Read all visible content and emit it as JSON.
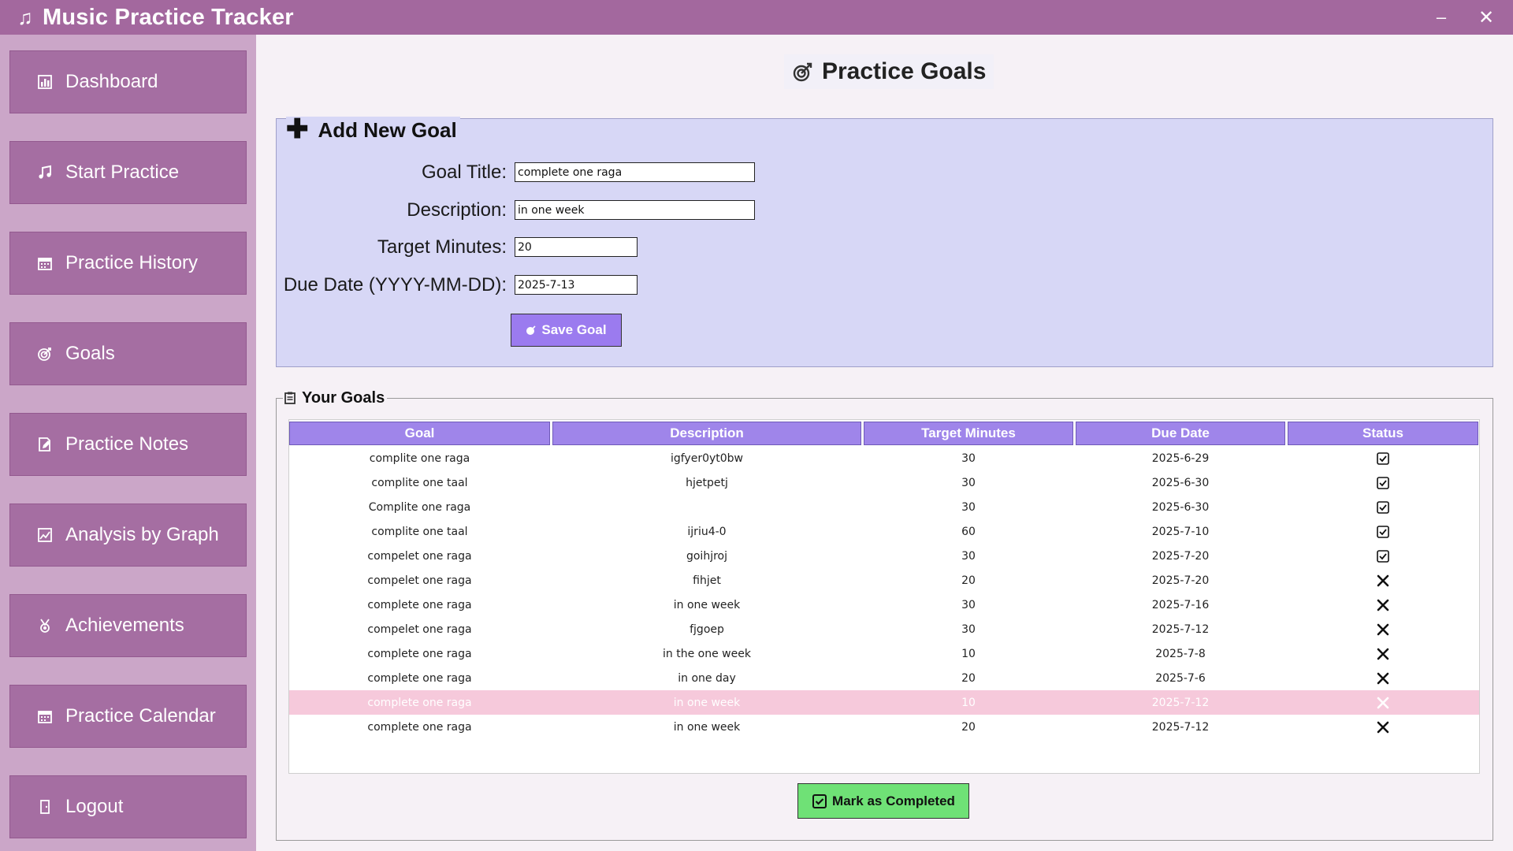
{
  "app": {
    "title": "Music Practice Tracker"
  },
  "window": {
    "minimize": "–",
    "close": "✕"
  },
  "sidebar": {
    "items": [
      {
        "label": "Dashboard",
        "icon": "bar-chart-icon"
      },
      {
        "label": "Start Practice",
        "icon": "music-note-icon"
      },
      {
        "label": "Practice History",
        "icon": "calendar-icon"
      },
      {
        "label": "Goals",
        "icon": "target-icon"
      },
      {
        "label": "Practice Notes",
        "icon": "note-edit-icon"
      },
      {
        "label": "Analysis by Graph",
        "icon": "line-chart-icon"
      },
      {
        "label": "Achievements",
        "icon": "medal-icon"
      },
      {
        "label": "Practice Calendar",
        "icon": "calendar-icon"
      },
      {
        "label": "Logout",
        "icon": "door-icon"
      }
    ]
  },
  "page": {
    "title": "Practice Goals"
  },
  "add_goal": {
    "legend": "Add New Goal",
    "fields": {
      "title": {
        "label": "Goal Title:",
        "value": "complete one raga"
      },
      "description": {
        "label": "Description:",
        "value": "in one week"
      },
      "target_minutes": {
        "label": "Target Minutes:",
        "value": "20"
      },
      "due_date": {
        "label": "Due Date (YYYY-MM-DD):",
        "value": "2025-7-13"
      }
    },
    "save_label": "Save Goal"
  },
  "goals": {
    "legend": "Your Goals",
    "columns": [
      "Goal",
      "Description",
      "Target Minutes",
      "Due Date",
      "Status"
    ],
    "rows": [
      {
        "goal": "complite one raga",
        "description": "igfyer0yt0bw",
        "target": "30",
        "due": "2025-6-29",
        "status": "completed",
        "selected": false
      },
      {
        "goal": "complite one taal",
        "description": "hjetpetj",
        "target": "30",
        "due": "2025-6-30",
        "status": "completed",
        "selected": false
      },
      {
        "goal": "Complite one raga",
        "description": "",
        "target": "30",
        "due": "2025-6-30",
        "status": "completed",
        "selected": false
      },
      {
        "goal": "complite one taal",
        "description": "ijriu4-0",
        "target": "60",
        "due": "2025-7-10",
        "status": "completed",
        "selected": false
      },
      {
        "goal": "compelet one raga",
        "description": "goihjroj",
        "target": "30",
        "due": "2025-7-20",
        "status": "completed",
        "selected": false
      },
      {
        "goal": "compelet one raga",
        "description": "fihjet",
        "target": "20",
        "due": "2025-7-20",
        "status": "pending",
        "selected": false
      },
      {
        "goal": "complete one raga",
        "description": "in one week",
        "target": "30",
        "due": "2025-7-16",
        "status": "pending",
        "selected": false
      },
      {
        "goal": "compelet one raga",
        "description": "fjgoep",
        "target": "30",
        "due": "2025-7-12",
        "status": "pending",
        "selected": false
      },
      {
        "goal": "complete one raga",
        "description": "in the one week",
        "target": "10",
        "due": "2025-7-8",
        "status": "pending",
        "selected": false
      },
      {
        "goal": "complete one raga",
        "description": "in one day",
        "target": "20",
        "due": "2025-7-6",
        "status": "pending",
        "selected": false
      },
      {
        "goal": "complete one raga",
        "description": "in one week",
        "target": "10",
        "due": "2025-7-12",
        "status": "pending",
        "selected": true
      },
      {
        "goal": "complete one raga",
        "description": "in one week",
        "target": "20",
        "due": "2025-7-12",
        "status": "pending",
        "selected": false
      }
    ],
    "mark_completed_label": "Mark as Completed"
  },
  "colors": {
    "titlebar": "#a3689e",
    "sidebar_bg": "#cba6c8",
    "sidebar_button": "#a56ea2",
    "form_panel": "#d7d7f6",
    "table_header": "#9f85ea",
    "save_button": "#9b7bef",
    "mark_button": "#6fe176",
    "selected_row": "#f6c9db"
  }
}
